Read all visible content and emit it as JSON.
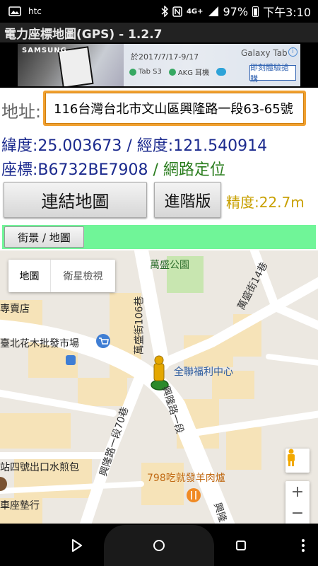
{
  "status_bar": {
    "carrier": "htc",
    "network": "4G+",
    "battery": "97%",
    "time": "下午3:10"
  },
  "app": {
    "title": "電力座標地圖(GPS) - 1.2.7"
  },
  "ad": {
    "brand_left": "SAMSUNG",
    "date_text": "於2017/7/17-9/17",
    "brand_right": "Galaxy Tab",
    "logos": [
      "Tab S3",
      "AKG 耳機"
    ],
    "cta": "即刻體驗搶購",
    "info": "i"
  },
  "location": {
    "address_label": "地址:",
    "address_value": "116台灣台北市文山區興隆路一段63-65號",
    "lat_lon_text": "緯度:25.003673 / 經度:121.540914",
    "coord_text": "座標:B6732BE7908",
    "source_text": " / 網路定位",
    "accuracy_text": "精度:22.7m"
  },
  "buttons": {
    "connect_map": "連結地圖",
    "advanced": "進階版",
    "street_view": "街景 / 地圖"
  },
  "map": {
    "maptype_map": "地圖",
    "maptype_satellite": "衛星檢視",
    "labels": {
      "park": "萬盛公園",
      "shop_left": "專賣店",
      "flower_market": "臺北花木批發市場",
      "store": "全聯福利中心",
      "street_wansheng_106": "萬盛街106巷",
      "street_wansheng_14": "萬盛街14巷",
      "street_xinglong_1": "興隆路一段",
      "street_xinglong_70": "興隆路一段70巷",
      "shop_pancake": "站四號出口水煎包",
      "restaurant": "798吃就發羊肉爐",
      "seat_cushion": "車座墊行",
      "road_right": "興隆"
    },
    "zoom_in": "+",
    "zoom_out": "−",
    "colors": {
      "background": "#ece8e1",
      "road": "#ffffff",
      "park": "#c8e6b0",
      "building": "#f6e3b8"
    }
  }
}
